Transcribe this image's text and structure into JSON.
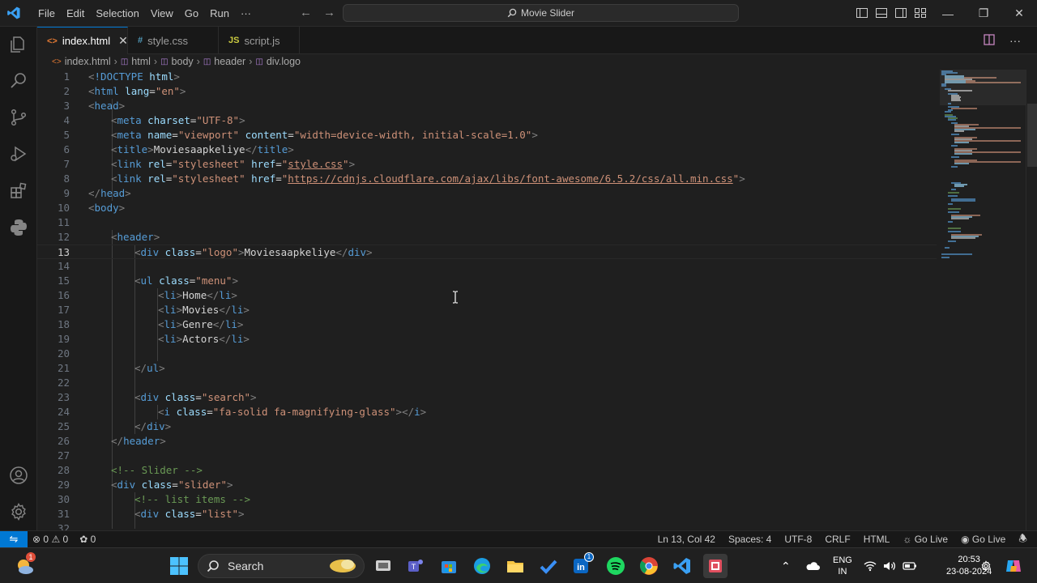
{
  "titlebar": {
    "menu": [
      "File",
      "Edit",
      "Selection",
      "View",
      "Go",
      "Run",
      "···"
    ],
    "command_center": "Movie Slider"
  },
  "tabs": [
    {
      "icon": "<>",
      "label": "index.html",
      "active": true
    },
    {
      "icon": "#",
      "label": "style.css",
      "active": false
    },
    {
      "icon": "JS",
      "label": "script.js",
      "active": false
    }
  ],
  "breadcrumb": [
    "index.html",
    "html",
    "body",
    "header",
    "div.logo"
  ],
  "editor": {
    "current_line": 13,
    "lines": [
      {
        "n": "1"
      },
      {
        "n": "2"
      },
      {
        "n": "3"
      },
      {
        "n": "4"
      },
      {
        "n": "5"
      },
      {
        "n": "6"
      },
      {
        "n": "7"
      },
      {
        "n": "8"
      },
      {
        "n": "9"
      },
      {
        "n": "10"
      },
      {
        "n": "11"
      },
      {
        "n": "12"
      },
      {
        "n": "13"
      },
      {
        "n": "14"
      },
      {
        "n": "15"
      },
      {
        "n": "16"
      },
      {
        "n": "17"
      },
      {
        "n": "18"
      },
      {
        "n": "19"
      },
      {
        "n": "20"
      },
      {
        "n": "21"
      },
      {
        "n": "22"
      },
      {
        "n": "23"
      },
      {
        "n": "24"
      },
      {
        "n": "25"
      },
      {
        "n": "26"
      },
      {
        "n": "27"
      },
      {
        "n": "28"
      },
      {
        "n": "29"
      },
      {
        "n": "30"
      },
      {
        "n": "31"
      },
      {
        "n": "32"
      }
    ],
    "code": {
      "l1_doctype": "!DOCTYPE",
      "l1_html": "html",
      "l2_tag": "html",
      "l2_attr": "lang",
      "l2_val": "\"en\"",
      "l3_tag": "head",
      "l4_tag": "meta",
      "l4_attr": "charset",
      "l4_val": "\"UTF-8\"",
      "l5_tag": "meta",
      "l5_attr1": "name",
      "l5_val1": "\"viewport\"",
      "l5_attr2": "content",
      "l5_val2": "\"width=device-width, initial-scale=1.0\"",
      "l6_tag": "title",
      "l6_text": "Moviesaapkeliye",
      "l7_tag": "link",
      "l7_attr1": "rel",
      "l7_val1": "\"stylesheet\"",
      "l7_attr2": "href",
      "l7_val2_q": "\"",
      "l7_val2": "style.css",
      "l8_tag": "link",
      "l8_attr1": "rel",
      "l8_val1": "\"stylesheet\"",
      "l8_attr2": "href",
      "l8_val2": "https://cdnjs.cloudflare.com/ajax/libs/font-awesome/6.5.2/css/all.min.css",
      "l9_tag": "head",
      "l10_tag": "body",
      "l12_tag": "header",
      "l13_tag": "div",
      "l13_attr": "class",
      "l13_val": "\"logo\"",
      "l13_text": "Moviesaapkeliye",
      "l15_tag": "ul",
      "l15_attr": "class",
      "l15_val": "\"menu\"",
      "li_tag": "li",
      "l16_text": "Home",
      "l17_text": "Movies",
      "l18_text": "Genre",
      "l19_text": "Actors",
      "l21_tag": "ul",
      "l23_tag": "div",
      "l23_attr": "class",
      "l23_val": "\"search\"",
      "l24_tag": "i",
      "l24_attr": "class",
      "l24_val": "\"fa-solid fa-magnifying-glass\"",
      "l25_tag": "div",
      "l26_tag": "header",
      "l28_comment": "<!-- Slider -->",
      "l29_tag": "div",
      "l29_attr": "class",
      "l29_val": "\"slider\"",
      "l30_comment": "<!-- list items -->",
      "l31_tag": "div",
      "l31_attr": "class",
      "l31_val": "\"list\""
    }
  },
  "statusbar": {
    "errors": "0",
    "warnings": "0",
    "ports": "0",
    "position": "Ln 13, Col 42",
    "spaces": "Spaces: 4",
    "encoding": "UTF-8",
    "eol": "CRLF",
    "language": "HTML",
    "golive1": "Go Live",
    "golive2": "Go Live"
  },
  "taskbar": {
    "search_label": "Search",
    "lang_line1": "ENG",
    "lang_line2": "IN",
    "time": "20:53",
    "date": "23-08-2024",
    "weather_badge": "1",
    "linkedin_badge": "1"
  },
  "colors": {
    "accent": "#0078d4",
    "tag": "#569cd6",
    "attr": "#9cdcfe",
    "string": "#ce9178",
    "comment": "#6a9955"
  }
}
